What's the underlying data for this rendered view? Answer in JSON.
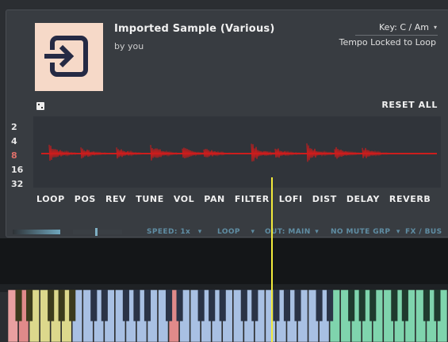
{
  "sample": {
    "title": "Imported Sample (Various)",
    "author": "by you",
    "artwork_icon": "import-arrow-icon"
  },
  "key": {
    "label": "Key: C  / Am",
    "caret": "▾"
  },
  "tempo_label": "Tempo Locked to Loop",
  "reset_label": "RESET ALL",
  "dice_icon": "dice-icon",
  "pitch_options": [
    {
      "label": "2",
      "active": false
    },
    {
      "label": "4",
      "active": false
    },
    {
      "label": "8",
      "active": true
    },
    {
      "label": "16",
      "active": false
    },
    {
      "label": "32",
      "active": false
    }
  ],
  "tabs": [
    "LOOP",
    "POS",
    "REV",
    "TUNE",
    "VOL",
    "PAN",
    "FILTER",
    "LOFI",
    "DIST",
    "DELAY",
    "REVERB"
  ],
  "controls": {
    "speed": "SPEED: 1x",
    "loop": "LOOP",
    "out": "OUT: MAIN",
    "mute": "NO MUTE GRP",
    "fx": "FX / BUS",
    "caret": "▾"
  },
  "colors": {
    "waveform": "#cc1d1d",
    "playhead": "#f3ea3b",
    "key_yellow": "#dcd88c",
    "key_blue": "#a8c0e3",
    "key_green": "#7fd4ad",
    "key_red": "#e08a8a",
    "control_text": "#5f8da3"
  },
  "keyboard": {
    "zones": [
      {
        "name": "yellow",
        "from": 1,
        "to": 6
      },
      {
        "name": "blue",
        "from": 6,
        "to": 30
      },
      {
        "name": "green",
        "from": 30,
        "to": 39
      }
    ],
    "red_keys": [
      1,
      15
    ]
  }
}
